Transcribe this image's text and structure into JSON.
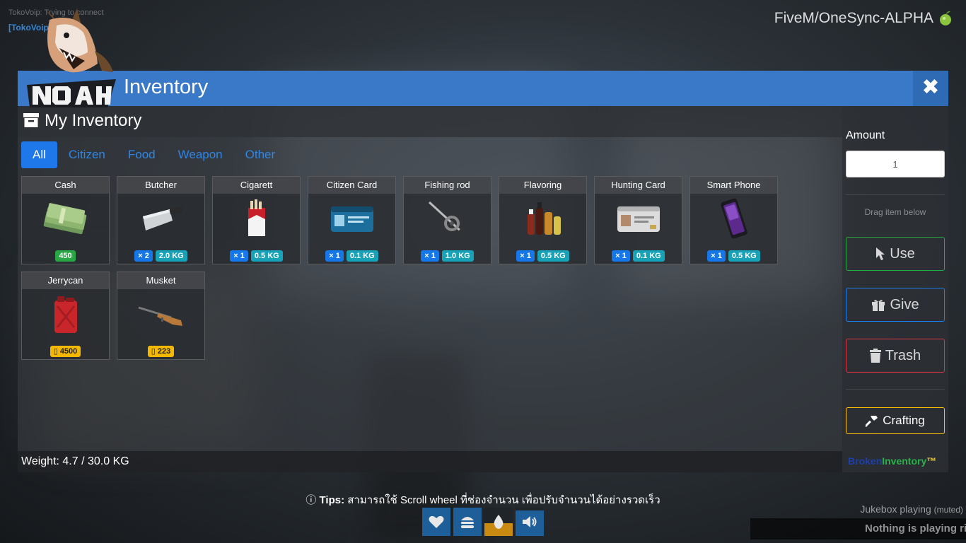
{
  "server": {
    "name": "FiveM/OneSync-ALPHA"
  },
  "corner": {
    "line1": "TokoVoip: Trying to connect",
    "line2": "[TokoVoip]"
  },
  "window": {
    "title": "Inventory",
    "close_label": "✖"
  },
  "panel": {
    "title": "My Inventory"
  },
  "tabs": [
    {
      "label": "All",
      "active": true
    },
    {
      "label": "Citizen",
      "active": false
    },
    {
      "label": "Food",
      "active": false
    },
    {
      "label": "Weapon",
      "active": false
    },
    {
      "label": "Other",
      "active": false
    }
  ],
  "items": [
    {
      "name": "Cash",
      "icon": "cash-stack-icon",
      "cash": "450"
    },
    {
      "name": "Butcher",
      "icon": "cleaver-icon",
      "qty": "× 2",
      "weight": "2.0 KG"
    },
    {
      "name": "Cigarett",
      "icon": "cigarette-pack-icon",
      "qty": "× 1",
      "weight": "0.5 KG"
    },
    {
      "name": "Citizen Card",
      "icon": "id-card-icon",
      "qty": "× 1",
      "weight": "0.1 KG"
    },
    {
      "name": "Fishing rod",
      "icon": "fishing-rod-icon",
      "qty": "× 1",
      "weight": "1.0 KG"
    },
    {
      "name": "Flavoring",
      "icon": "bottles-icon",
      "qty": "× 1",
      "weight": "0.5 KG"
    },
    {
      "name": "Hunting Card",
      "icon": "hunting-card-icon",
      "qty": "× 1",
      "weight": "0.1 KG"
    },
    {
      "name": "Smart Phone",
      "icon": "smartphone-icon",
      "qty": "× 1",
      "weight": "0.5 KG"
    },
    {
      "name": "Jerrycan",
      "icon": "jerrycan-icon",
      "ammo": "4500"
    },
    {
      "name": "Musket",
      "icon": "musket-icon",
      "ammo": "223"
    }
  ],
  "weight": {
    "text": "Weight: 4.7 / 30.0 KG"
  },
  "side": {
    "amount_label": "Amount",
    "amount_value": "1",
    "drag_hint": "Drag item below",
    "use_label": "Use",
    "give_label": "Give",
    "trash_label": "Trash",
    "craft_label": "Crafting",
    "brand_part1": "Broken",
    "brand_part2": "Inventory",
    "brand_part3": "™"
  },
  "tips": {
    "prefix": "Tips:",
    "text": "สามารถใช้ Scroll wheel ที่ช่องจำนวน เพื่อปรับจำนวนได้อย่างรวดเร็ว"
  },
  "hud": [
    {
      "icon": "heart-icon",
      "level": 1.0,
      "color": "#1f5f99"
    },
    {
      "icon": "burger-icon",
      "level": 1.0,
      "color": "#1f5f99"
    },
    {
      "icon": "water-drop-icon",
      "level": 0.45,
      "color": "#c98a12"
    },
    {
      "icon": "speaker-icon",
      "level": 0.9,
      "color": "#1f5f99"
    }
  ],
  "jukebox": {
    "label": "Jukebox playing",
    "state": "(muted)",
    "now_playing": "Nothing is playing right now"
  },
  "colors": {
    "titlebar": "#3a78c8",
    "tab_active": "#1f78ea",
    "use": "#28a745",
    "give": "#1a7ff0",
    "trash": "#dc3545",
    "craft": "#ffc107"
  }
}
